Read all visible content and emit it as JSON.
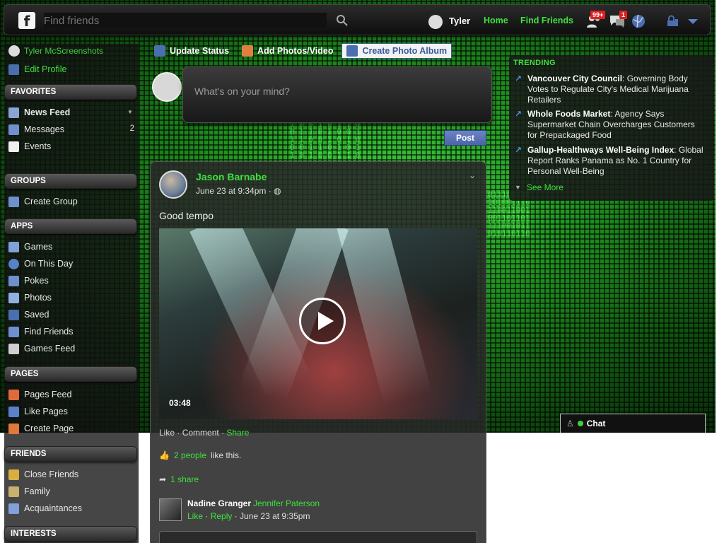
{
  "topbar": {
    "search_placeholder": "Find friends",
    "user_name": "Tyler",
    "nav_home": "Home",
    "nav_find_friends": "Find Friends",
    "badge_friend_requests": "99+",
    "badge_messages": "1"
  },
  "sidebar": {
    "profile_name": "Tyler McScreenshots",
    "edit_profile": "Edit Profile",
    "favorites_title": "FAVORITES",
    "favorites": [
      {
        "label": "News Feed"
      },
      {
        "label": "Messages",
        "count": "2"
      },
      {
        "label": "Events"
      }
    ],
    "groups_title": "GROUPS",
    "groups": [
      {
        "label": "Create Group"
      }
    ],
    "apps_title": "APPS",
    "apps": [
      {
        "label": "Games"
      },
      {
        "label": "On This Day"
      },
      {
        "label": "Pokes"
      },
      {
        "label": "Photos"
      },
      {
        "label": "Saved"
      },
      {
        "label": "Find Friends"
      },
      {
        "label": "Games Feed"
      }
    ],
    "pages_title": "PAGES",
    "pages": [
      {
        "label": "Pages Feed"
      },
      {
        "label": "Like Pages"
      },
      {
        "label": "Create Page"
      }
    ],
    "friends_title": "FRIENDS",
    "friends": [
      {
        "label": "Close Friends"
      },
      {
        "label": "Family"
      },
      {
        "label": "Acquaintances"
      }
    ],
    "interests_title": "INTERESTS"
  },
  "composer": {
    "tab_status": "Update Status",
    "tab_photos": "Add Photos/Video",
    "tab_album": "Create Photo Album",
    "placeholder": "What's on your mind?",
    "post_label": "Post"
  },
  "story": {
    "author": "Jason Barnabe",
    "time": "June 23 at 9:34pm",
    "text": "Good tempo",
    "video_duration": "03:48",
    "action_like": "Like",
    "action_comment": "Comment",
    "action_share": "Share",
    "likes_link": "2 people",
    "likes_suffix": "like this.",
    "shares_link": "1 share",
    "comment": {
      "author": "Nadine Granger",
      "text": "Jennifer Paterson",
      "like": "Like",
      "reply": "Reply",
      "time": "June 23 at 9:35pm"
    }
  },
  "trending": {
    "title": "TRENDING",
    "items": [
      {
        "topic": "Vancouver City Council",
        "headline": ": Governing Body Votes to Regulate City's Medical Marijuana Retailers"
      },
      {
        "topic": "Whole Foods Market",
        "headline": ": Agency Says Supermarket Chain Overcharges Customers for Prepackaged Food"
      },
      {
        "topic": "Gallup-Healthways Well-Being Index",
        "headline": ": Global Report Ranks Panama as No. 1 Country for Personal Well-Being"
      }
    ],
    "see_more": "See More"
  },
  "chat": {
    "label": "Chat"
  },
  "colors": {
    "accent_green": "#3fe03f",
    "fb_blue": "#3b5998",
    "badge_red": "#e02020"
  }
}
